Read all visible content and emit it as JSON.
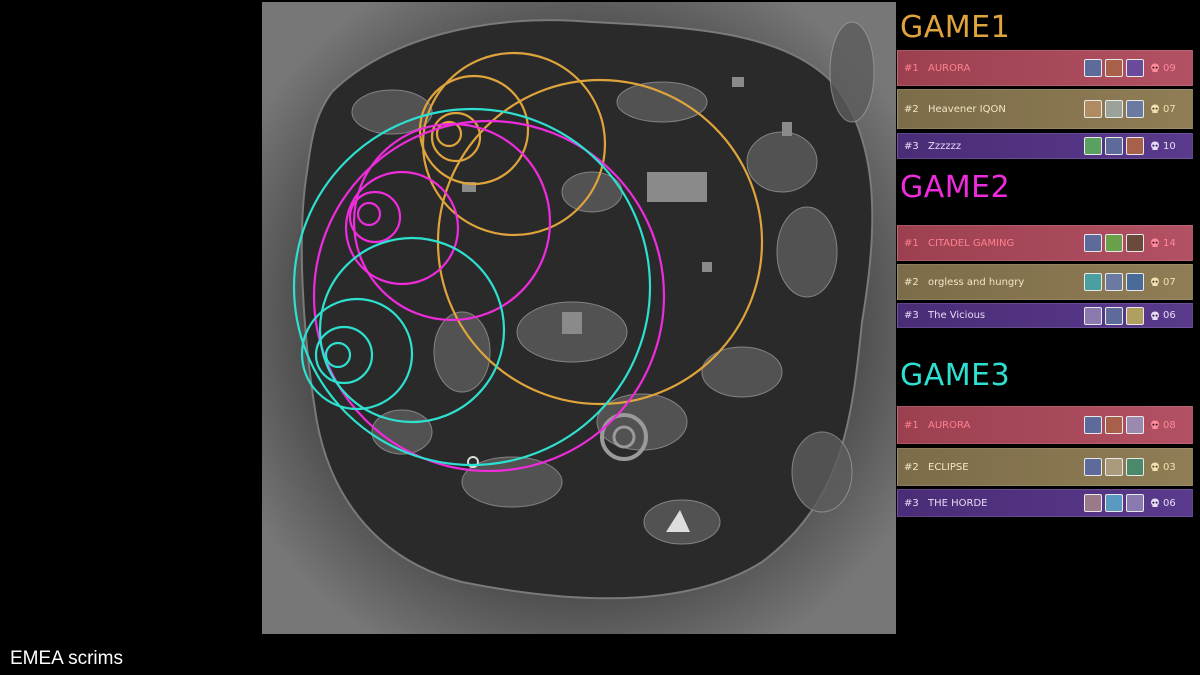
{
  "caption": "EMEA scrims",
  "colors": {
    "game1": "#e0a43c",
    "game2": "#ee2cdc",
    "game3": "#2ee0d0"
  },
  "games": [
    {
      "title": "GAME1",
      "rows": [
        {
          "rank": "#1",
          "team": "AURORA",
          "kills": "09"
        },
        {
          "rank": "#2",
          "team": "Heavener IQON",
          "kills": "07"
        },
        {
          "rank": "#3",
          "team": "Zzzzzz",
          "kills": "10"
        }
      ]
    },
    {
      "title": "GAME2",
      "rows": [
        {
          "rank": "#1",
          "team": "CITADEL GAMING",
          "kills": "14"
        },
        {
          "rank": "#2",
          "team": "orgless and hungry",
          "kills": "07"
        },
        {
          "rank": "#3",
          "team": "The Vicious",
          "kills": "06"
        }
      ]
    },
    {
      "title": "GAME3",
      "rows": [
        {
          "rank": "#1",
          "team": "AURORA",
          "kills": "08"
        },
        {
          "rank": "#2",
          "team": "ECLIPSE",
          "kills": "03"
        },
        {
          "rank": "#3",
          "team": "THE HORDE",
          "kills": "06"
        }
      ]
    }
  ],
  "icons": {
    "kills": "skull-icon",
    "player": "legend-portrait-icon"
  }
}
